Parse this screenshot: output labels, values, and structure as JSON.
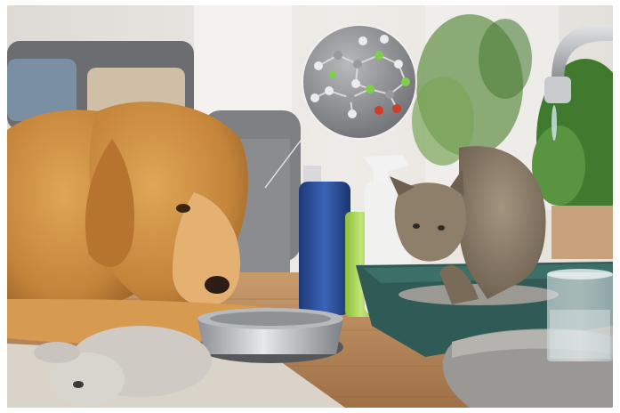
{
  "image": {
    "kind": "photo-illustration",
    "subjects": [
      "golden-retriever",
      "tabby-cat",
      "molecule-inset",
      "faucet",
      "cleaning-bottles",
      "litter-box",
      "water-glass",
      "food-bowl",
      "plush-toy",
      "pet-bed",
      "houseplants",
      "sofa",
      "rug"
    ],
    "palette": {
      "wall": "#e9e6e2",
      "floor": "#b98a5f",
      "dog_fur": "#c98a3f",
      "cat_fur": "#8a7a66",
      "litter_box": "#2f5a55",
      "blue_bottle": "#2a4f9c",
      "green_bottle": "#9fd14a",
      "plant": "#4f8a3a",
      "molecule_bg": "#8e8f92"
    }
  }
}
